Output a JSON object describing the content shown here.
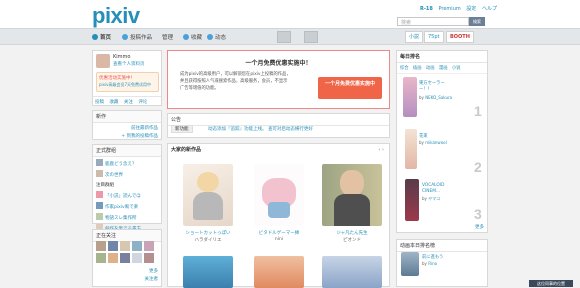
{
  "header": {
    "logo": "pixiv",
    "search_placeholder": "検索",
    "search_button": "検索",
    "r18": "R-18",
    "premium": "Premium",
    "settings": "設定",
    "help": "ヘルプ",
    "notify_count": "小説",
    "points": "75pt",
    "booth": "BOOTH"
  },
  "nav": {
    "home": "首页",
    "post": "投稿作品",
    "manage": "管理",
    "bookmark": "收藏",
    "feed": "动态"
  },
  "profile": {
    "name": "Kimmo",
    "view_profile": "查看个人资料页",
    "premium_line1": "优惠活动实施中！",
    "premium_line2": "pixiv高级会员7天免费试用中",
    "tabs": [
      "投稿",
      "收藏",
      "关注",
      "评论"
    ]
  },
  "novel_box": {
    "title": "新作",
    "link1": "前往最新作品",
    "link2": "+ 到我的投稿作品"
  },
  "groups": {
    "title": "正式群组",
    "items": [
      "鹿鹿どう念え？",
      "次の世界",
      "注目群組",
      "「小説」読んでほ",
      "作家pixiv風で楽",
      "物語スレ集作所",
      "創作を愛でる貴方"
    ]
  },
  "following": {
    "title": "正在关注",
    "more1": "更多",
    "more2": "关注者"
  },
  "promo": {
    "title": "一个月免费优惠实施中！",
    "body1": "成为pixiv的高级用户，可以解锁您在pixiv上投稿的作品，",
    "body2": "并且获得按照人气或搜索作品，高级服务，会员，不显示",
    "body3": "广告等增值的功能。",
    "button": "一个月免费优惠实施中"
  },
  "notice": {
    "title": "公告",
    "tag": "新功能",
    "text": "动态添加『追踪』功能上线。",
    "link": "查可对后动态横行更好"
  },
  "works": {
    "title": "大家的新作品",
    "items": [
      {
        "title": "ショートカットっぽい",
        "author": "ハラダイリエ"
      },
      {
        "title": "ビタドルゲーマー挿",
        "author": "nini"
      },
      {
        "title": "ジャ凡たん先生",
        "author": "ピオンド"
      }
    ]
  },
  "ranking": {
    "title": "每日排名",
    "tabs": [
      "综合",
      "插画",
      "动画",
      "漫画",
      "小说"
    ],
    "items": [
      {
        "rank": "1",
        "title": "東方セーラー\n ー！！",
        "by": "by",
        "author": "NEKO_Sakura"
      },
      {
        "rank": "2",
        "title": "花束",
        "by": "by",
        "author": "mikanwool"
      },
      {
        "rank": "3",
        "title": "VOCALOID\nCINEM...",
        "by": "by",
        "author": "ヤマコ"
      }
    ],
    "more": "更多"
  },
  "novel_rank": {
    "title": "动画本日排名榜",
    "item_title": "前に進もう",
    "by": "by",
    "author": "Rino"
  },
  "report": "这位同事的位置"
}
